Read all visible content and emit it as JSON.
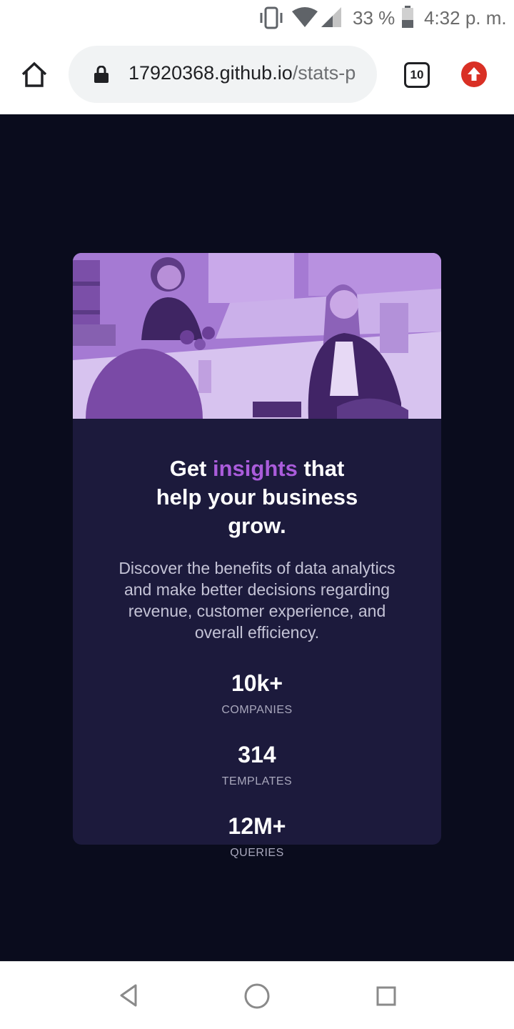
{
  "status_bar": {
    "battery_percent": "33 %",
    "time": "4:32 p. m.",
    "icons": [
      "vibrate-icon",
      "wifi-icon",
      "signal-icon",
      "battery-icon"
    ]
  },
  "browser": {
    "url_host": "17920368.github.io",
    "url_path": "/stats-p",
    "tab_count": "10",
    "icons": [
      "home-icon",
      "lock-icon",
      "update-icon"
    ]
  },
  "card": {
    "image_alt": "hero image of women working at a table",
    "headline": {
      "part1": "Get ",
      "accent": "insights",
      "part2": " that",
      "line2": "help your business",
      "line3": "grow."
    },
    "description": "Discover the benefits of data analytics and make better decisions regarding revenue, customer experience, and overall efficiency.",
    "stats": [
      {
        "value": "10k+",
        "label": "COMPANIES"
      },
      {
        "value": "314",
        "label": "TEMPLATES"
      },
      {
        "value": "12M+",
        "label": "QUERIES"
      }
    ]
  },
  "colors": {
    "page_background": "#0a0c1d",
    "card_background": "#1c1a3c",
    "accent": "#aa5cdb",
    "image_tint": "#a97ad8"
  },
  "nav": {
    "icons": [
      "back-icon",
      "home-circle-icon",
      "recents-icon"
    ]
  }
}
